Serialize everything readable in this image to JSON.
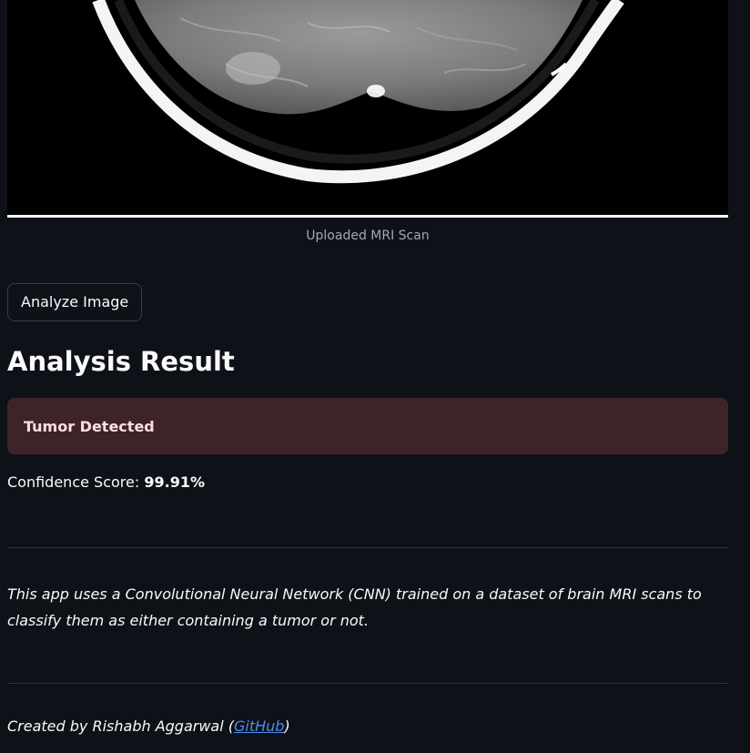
{
  "image": {
    "caption": "Uploaded MRI Scan"
  },
  "actions": {
    "analyze_label": "Analyze Image"
  },
  "result": {
    "heading": "Analysis Result",
    "alert_text": "Tumor Detected",
    "alert_color": "#3e2428",
    "confidence_label": "Confidence Score:",
    "confidence_value": "99.91%"
  },
  "about": {
    "description": "This app uses a Convolutional Neural Network (CNN) trained on a dataset of brain MRI scans to classify them as either containing a tumor or not."
  },
  "footer": {
    "prefix": "Created by Rishabh Aggarwal (",
    "link_label": "GitHub",
    "suffix": ")"
  },
  "colors": {
    "background": "#0e1117",
    "link": "#4a8ef0"
  }
}
